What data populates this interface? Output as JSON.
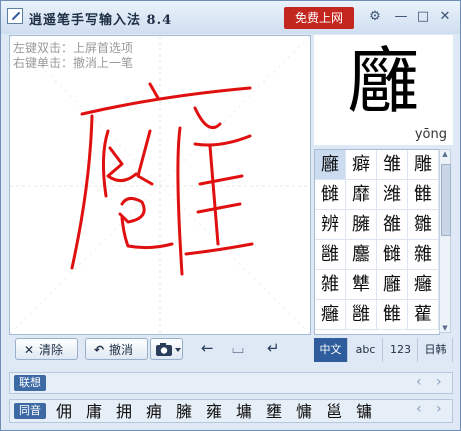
{
  "window": {
    "title": "逍遥笔手写输入法 8.4",
    "promo_button": "免费上网",
    "controls": {
      "settings": "⚙",
      "minimize": "—",
      "maximize": "□",
      "close": "✕"
    }
  },
  "canvas": {
    "hint_line1": "左键双击：上屏首选项",
    "hint_line2": "右键单击：撤消上一笔",
    "ink_color": "#e01010"
  },
  "toolbar": {
    "clear_label": "清除",
    "undo_label": "撤消",
    "left_arrow": "←",
    "space_glyph": "⌴",
    "enter_glyph": "↵"
  },
  "preview": {
    "character": "廱",
    "pinyin": "yōng"
  },
  "candidates": [
    [
      "廱",
      "癖",
      "雏",
      "雕"
    ],
    [
      "雠",
      "靡",
      "潍",
      "雔"
    ],
    [
      "辨",
      "臃",
      "雒",
      "雛"
    ],
    [
      "雝",
      "麢",
      "雠",
      "雜"
    ],
    [
      "雑",
      "犨",
      "廱",
      "癰"
    ],
    [
      "癰",
      "雝",
      "雔",
      "雚"
    ]
  ],
  "mode_tabs": [
    "中文",
    "abc",
    "123",
    "日韩"
  ],
  "association": {
    "label": "联想",
    "prev": "‹",
    "next": "›"
  },
  "homophones": {
    "label": "同音",
    "items": [
      "佣",
      "庸",
      "拥",
      "痈",
      "臃",
      "雍",
      "墉",
      "壅",
      "慵",
      "邕",
      "镛"
    ],
    "prev": "‹",
    "next": "›"
  },
  "colors": {
    "accent": "#2e5c9c",
    "promo": "#c3261f",
    "ink": "#e01010"
  }
}
